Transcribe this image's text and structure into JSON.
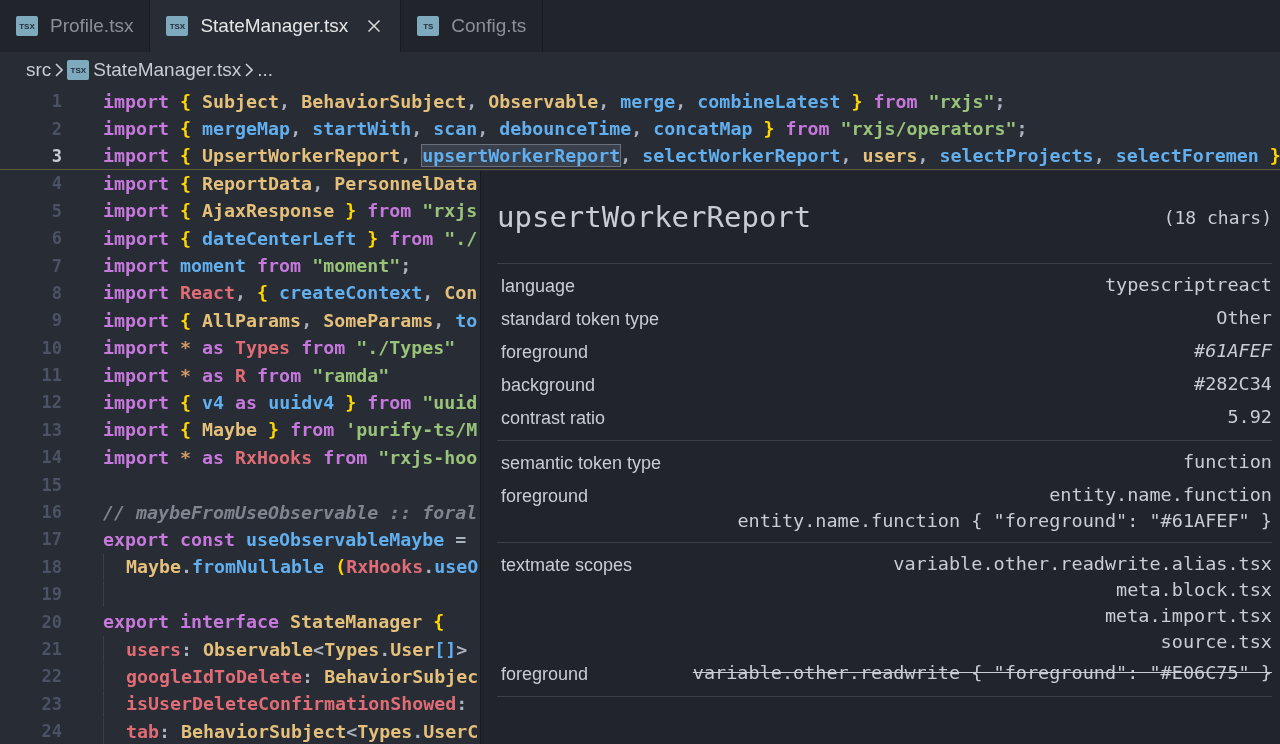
{
  "tabs": [
    {
      "label": "Profile.tsx",
      "icon_label": "TSX",
      "selected": false
    },
    {
      "label": "StateManager.tsx",
      "icon_label": "TSX",
      "selected": true
    },
    {
      "label": "Config.ts",
      "icon_label": "TS",
      "selected": false
    }
  ],
  "breadcrumb": {
    "folder": "src",
    "icon_label": "TSX",
    "file": "StateManager.tsx",
    "more": "..."
  },
  "editor": {
    "lines": [
      {
        "number": "1",
        "current": false,
        "indent": false,
        "tokens": [
          {
            "kind": "keyword",
            "text": "import "
          },
          {
            "kind": "bracket",
            "text": "{ "
          },
          {
            "kind": "type",
            "text": "Subject"
          },
          {
            "kind": "punctuation",
            "text": ", "
          },
          {
            "kind": "type",
            "text": "BehaviorSubject"
          },
          {
            "kind": "punctuation",
            "text": ", "
          },
          {
            "kind": "type",
            "text": "Observable"
          },
          {
            "kind": "punctuation",
            "text": ", "
          },
          {
            "kind": "function",
            "text": "merge"
          },
          {
            "kind": "punctuation",
            "text": ", "
          },
          {
            "kind": "function",
            "text": "combineLatest "
          },
          {
            "kind": "bracket",
            "text": "} "
          },
          {
            "kind": "keyword",
            "text": "from "
          },
          {
            "kind": "string",
            "text": "\"rxjs\""
          },
          {
            "kind": "punctuation",
            "text": ";"
          }
        ]
      },
      {
        "number": "2",
        "current": false,
        "indent": false,
        "tokens": [
          {
            "kind": "keyword",
            "text": "import "
          },
          {
            "kind": "bracket",
            "text": "{ "
          },
          {
            "kind": "function",
            "text": "mergeMap"
          },
          {
            "kind": "punctuation",
            "text": ", "
          },
          {
            "kind": "function",
            "text": "startWith"
          },
          {
            "kind": "punctuation",
            "text": ", "
          },
          {
            "kind": "function",
            "text": "scan"
          },
          {
            "kind": "punctuation",
            "text": ", "
          },
          {
            "kind": "function",
            "text": "debounceTime"
          },
          {
            "kind": "punctuation",
            "text": ", "
          },
          {
            "kind": "function",
            "text": "concatMap "
          },
          {
            "kind": "bracket",
            "text": "} "
          },
          {
            "kind": "keyword",
            "text": "from "
          },
          {
            "kind": "string",
            "text": "\"rxjs/operators\""
          },
          {
            "kind": "punctuation",
            "text": ";"
          }
        ]
      },
      {
        "number": "3",
        "current": true,
        "indent": false,
        "tokens": [
          {
            "kind": "keyword",
            "text": "import ",
            "highlighted": false
          },
          {
            "kind": "bracket",
            "text": "{ ",
            "highlighted": false
          },
          {
            "kind": "type",
            "text": "UpsertWorkerReport",
            "highlighted": false
          },
          {
            "kind": "punctuation",
            "text": ", ",
            "highlighted": false
          },
          {
            "kind": "function",
            "text": "upsertWorkerReport",
            "highlighted": true
          },
          {
            "kind": "punctuation",
            "text": ", ",
            "highlighted": false
          },
          {
            "kind": "function",
            "text": "selectWorkerReport",
            "highlighted": false
          },
          {
            "kind": "punctuation",
            "text": ", ",
            "highlighted": false
          },
          {
            "kind": "type",
            "text": "users",
            "highlighted": false
          },
          {
            "kind": "punctuation",
            "text": ", ",
            "highlighted": false
          },
          {
            "kind": "function",
            "text": "selectProjects",
            "highlighted": false
          },
          {
            "kind": "punctuation",
            "text": ", ",
            "highlighted": false
          },
          {
            "kind": "function",
            "text": "selectForemen ",
            "highlighted": false
          },
          {
            "kind": "bracket",
            "text": "}",
            "highlighted": false
          }
        ]
      },
      {
        "number": "4",
        "current": false,
        "indent": false,
        "tokens": [
          {
            "kind": "keyword",
            "text": "import "
          },
          {
            "kind": "bracket",
            "text": "{ "
          },
          {
            "kind": "type",
            "text": "ReportData"
          },
          {
            "kind": "punctuation",
            "text": ", "
          },
          {
            "kind": "type",
            "text": "PersonnelData"
          }
        ]
      },
      {
        "number": "5",
        "current": false,
        "indent": false,
        "tokens": [
          {
            "kind": "keyword",
            "text": "import "
          },
          {
            "kind": "bracket",
            "text": "{ "
          },
          {
            "kind": "type",
            "text": "AjaxResponse "
          },
          {
            "kind": "bracket",
            "text": "} "
          },
          {
            "kind": "keyword",
            "text": "from "
          },
          {
            "kind": "string",
            "text": "\"rxjs"
          }
        ]
      },
      {
        "number": "6",
        "current": false,
        "indent": false,
        "tokens": [
          {
            "kind": "keyword",
            "text": "import "
          },
          {
            "kind": "bracket",
            "text": "{ "
          },
          {
            "kind": "function",
            "text": "dateCenterLeft "
          },
          {
            "kind": "bracket",
            "text": "} "
          },
          {
            "kind": "keyword",
            "text": "from "
          },
          {
            "kind": "string",
            "text": "\"./"
          }
        ]
      },
      {
        "number": "7",
        "current": false,
        "indent": false,
        "tokens": [
          {
            "kind": "keyword",
            "text": "import "
          },
          {
            "kind": "function",
            "text": "moment "
          },
          {
            "kind": "keyword",
            "text": "from "
          },
          {
            "kind": "string",
            "text": "\"moment\""
          },
          {
            "kind": "punctuation",
            "text": ";"
          }
        ]
      },
      {
        "number": "8",
        "current": false,
        "indent": false,
        "tokens": [
          {
            "kind": "keyword",
            "text": "import "
          },
          {
            "kind": "variable",
            "text": "React"
          },
          {
            "kind": "punctuation",
            "text": ", "
          },
          {
            "kind": "bracket",
            "text": "{ "
          },
          {
            "kind": "function",
            "text": "createContext"
          },
          {
            "kind": "punctuation",
            "text": ", "
          },
          {
            "kind": "type",
            "text": "Con"
          }
        ]
      },
      {
        "number": "9",
        "current": false,
        "indent": false,
        "tokens": [
          {
            "kind": "keyword",
            "text": "import "
          },
          {
            "kind": "bracket",
            "text": "{ "
          },
          {
            "kind": "type",
            "text": "AllParams"
          },
          {
            "kind": "punctuation",
            "text": ", "
          },
          {
            "kind": "type",
            "text": "SomeParams"
          },
          {
            "kind": "punctuation",
            "text": ", "
          },
          {
            "kind": "function",
            "text": "to"
          }
        ]
      },
      {
        "number": "10",
        "current": false,
        "indent": false,
        "tokens": [
          {
            "kind": "keyword",
            "text": "import "
          },
          {
            "kind": "operator",
            "text": "* "
          },
          {
            "kind": "keyword",
            "text": "as "
          },
          {
            "kind": "variable",
            "text": "Types "
          },
          {
            "kind": "keyword",
            "text": "from "
          },
          {
            "kind": "string",
            "text": "\"./Types\""
          }
        ]
      },
      {
        "number": "11",
        "current": false,
        "indent": false,
        "tokens": [
          {
            "kind": "keyword",
            "text": "import "
          },
          {
            "kind": "operator",
            "text": "* "
          },
          {
            "kind": "keyword",
            "text": "as "
          },
          {
            "kind": "variable",
            "text": "R "
          },
          {
            "kind": "keyword",
            "text": "from "
          },
          {
            "kind": "string",
            "text": "\"ramda\""
          }
        ]
      },
      {
        "number": "12",
        "current": false,
        "indent": false,
        "tokens": [
          {
            "kind": "keyword",
            "text": "import "
          },
          {
            "kind": "bracket",
            "text": "{ "
          },
          {
            "kind": "function",
            "text": "v4 "
          },
          {
            "kind": "keyword",
            "text": "as "
          },
          {
            "kind": "function",
            "text": "uuidv4 "
          },
          {
            "kind": "bracket",
            "text": "} "
          },
          {
            "kind": "keyword",
            "text": "from "
          },
          {
            "kind": "string",
            "text": "\"uuid"
          }
        ]
      },
      {
        "number": "13",
        "current": false,
        "indent": false,
        "tokens": [
          {
            "kind": "keyword",
            "text": "import "
          },
          {
            "kind": "bracket",
            "text": "{ "
          },
          {
            "kind": "type",
            "text": "Maybe "
          },
          {
            "kind": "bracket",
            "text": "} "
          },
          {
            "kind": "keyword",
            "text": "from "
          },
          {
            "kind": "string",
            "text": "'purify-ts/M"
          }
        ]
      },
      {
        "number": "14",
        "current": false,
        "indent": false,
        "tokens": [
          {
            "kind": "keyword",
            "text": "import "
          },
          {
            "kind": "operator",
            "text": "* "
          },
          {
            "kind": "keyword",
            "text": "as "
          },
          {
            "kind": "variable",
            "text": "RxHooks "
          },
          {
            "kind": "keyword",
            "text": "from "
          },
          {
            "kind": "string",
            "text": "\"rxjs-hoo"
          }
        ]
      },
      {
        "number": "15",
        "current": false,
        "indent": false
      },
      {
        "number": "16",
        "current": false,
        "indent": false,
        "tokens": [
          {
            "kind": "comment",
            "text": "// maybeFromUseObservable :: foral"
          }
        ]
      },
      {
        "number": "17",
        "current": false,
        "indent": false,
        "tokens": [
          {
            "kind": "keyword",
            "text": "export "
          },
          {
            "kind": "keyword",
            "text": "const "
          },
          {
            "kind": "function",
            "text": "useObservableMaybe "
          },
          {
            "kind": "punctuation",
            "text": "="
          }
        ]
      },
      {
        "number": "18",
        "current": false,
        "indent": true,
        "tokens": [
          {
            "kind": "type",
            "text": "Maybe"
          },
          {
            "kind": "punctuation",
            "text": "."
          },
          {
            "kind": "function",
            "text": "fromNullable "
          },
          {
            "kind": "bracket",
            "text": "("
          },
          {
            "kind": "variable",
            "text": "RxHooks"
          },
          {
            "kind": "punctuation",
            "text": "."
          },
          {
            "kind": "function",
            "text": "useO"
          }
        ]
      },
      {
        "number": "19",
        "current": false,
        "indent": true
      },
      {
        "number": "20",
        "current": false,
        "indent": false,
        "tokens": [
          {
            "kind": "keyword",
            "text": "export "
          },
          {
            "kind": "keyword",
            "text": "interface "
          },
          {
            "kind": "type",
            "text": "StateManager "
          },
          {
            "kind": "bracket",
            "text": "{"
          }
        ]
      },
      {
        "number": "21",
        "current": false,
        "indent": true,
        "tokens": [
          {
            "kind": "variable",
            "text": "users"
          },
          {
            "kind": "punctuation",
            "text": ": "
          },
          {
            "kind": "type",
            "text": "Observable"
          },
          {
            "kind": "punctuation",
            "text": "<"
          },
          {
            "kind": "type",
            "text": "Types"
          },
          {
            "kind": "punctuation",
            "text": "."
          },
          {
            "kind": "type",
            "text": "User"
          },
          {
            "kind": "function",
            "text": "[]"
          },
          {
            "kind": "punctuation",
            "text": ">"
          }
        ]
      },
      {
        "number": "22",
        "current": false,
        "indent": true,
        "tokens": [
          {
            "kind": "variable",
            "text": "googleIdToDelete"
          },
          {
            "kind": "punctuation",
            "text": ": "
          },
          {
            "kind": "type",
            "text": "BehaviorSubjec"
          }
        ]
      },
      {
        "number": "23",
        "current": false,
        "indent": true,
        "tokens": [
          {
            "kind": "variable",
            "text": "isUserDeleteConfirmationShowed"
          },
          {
            "kind": "punctuation",
            "text": ":"
          }
        ]
      },
      {
        "number": "24",
        "current": false,
        "indent": true,
        "tokens": [
          {
            "kind": "variable",
            "text": "tab"
          },
          {
            "kind": "punctuation",
            "text": ": "
          },
          {
            "kind": "type",
            "text": "BehaviorSubject"
          },
          {
            "kind": "punctuation",
            "text": "<"
          },
          {
            "kind": "type",
            "text": "Types"
          },
          {
            "kind": "punctuation",
            "text": "."
          },
          {
            "kind": "type",
            "text": "UserC"
          }
        ]
      }
    ]
  },
  "hover": {
    "title": "upsertWorkerReport",
    "count": "(18 chars)",
    "sections": [
      [
        {
          "label": "language",
          "values": [
            "typescriptreact"
          ],
          "italic": false,
          "struck": false
        },
        {
          "label": "standard token type",
          "values": [
            "Other"
          ],
          "italic": false,
          "struck": false
        },
        {
          "label": "foreground",
          "values": [
            "#61AFEF"
          ],
          "italic": true,
          "struck": false
        },
        {
          "label": "background",
          "values": [
            "#282C34"
          ],
          "italic": false,
          "struck": false
        },
        {
          "label": "contrast ratio",
          "values": [
            "5.92"
          ],
          "italic": false,
          "struck": false
        }
      ],
      [
        {
          "label": "semantic token type",
          "values": [
            "function"
          ],
          "italic": false,
          "struck": false
        },
        {
          "label": "foreground",
          "values": [
            "entity.name.function",
            "entity.name.function { \"foreground\": \"#61AFEF\" }"
          ],
          "italic": false,
          "struck": false
        }
      ],
      [
        {
          "label": "textmate scopes",
          "values": [
            "variable.other.readwrite.alias.tsx",
            "meta.block.tsx",
            "meta.import.tsx",
            "source.tsx"
          ],
          "italic": false,
          "struck": false
        },
        {
          "label": "foreground",
          "values": [
            "variable.other.readwrite { \"foreground\": \"#E06C75\" }"
          ],
          "italic": false,
          "struck": true
        }
      ]
    ]
  }
}
